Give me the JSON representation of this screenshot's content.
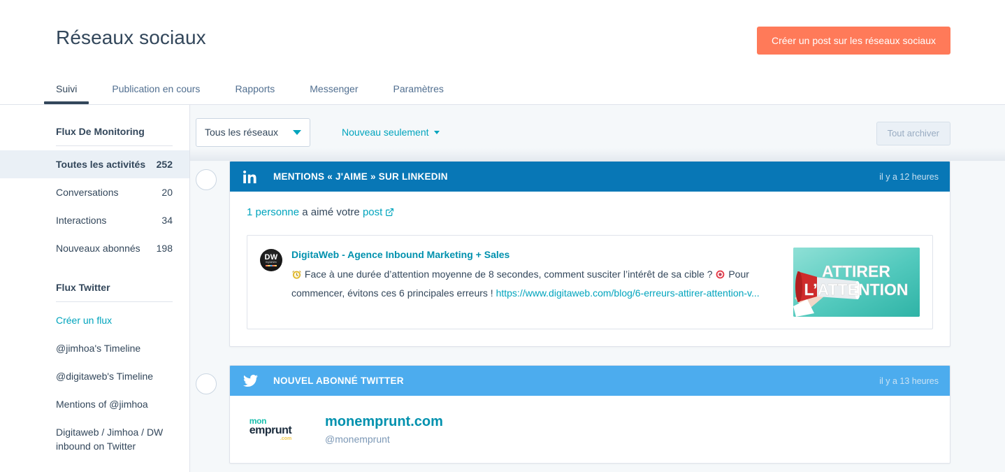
{
  "header": {
    "title": "Réseaux sociaux",
    "primary_button": "Créer un post sur les réseaux sociaux",
    "accent_color": "#ff7a59",
    "tabs": [
      {
        "label": "Suivi",
        "active": true
      },
      {
        "label": "Publication en cours",
        "active": false
      },
      {
        "label": "Rapports",
        "active": false
      },
      {
        "label": "Messenger",
        "active": false
      },
      {
        "label": "Paramètres",
        "active": false
      }
    ]
  },
  "sidebar": {
    "monitoring": {
      "title": "Flux De Monitoring",
      "items": [
        {
          "label": "Toutes les activités",
          "count": "252",
          "selected": true
        },
        {
          "label": "Conversations",
          "count": "20",
          "selected": false
        },
        {
          "label": "Interactions",
          "count": "34",
          "selected": false
        },
        {
          "label": "Nouveaux abonnés",
          "count": "198",
          "selected": false
        }
      ]
    },
    "twitter": {
      "title": "Flux Twitter",
      "items": [
        {
          "label": "Créer un flux",
          "teal": true
        },
        {
          "label": "@jimhoa's Timeline",
          "teal": false
        },
        {
          "label": "@digitaweb's Timeline",
          "teal": false
        },
        {
          "label": "Mentions of @jimhoa",
          "teal": false
        },
        {
          "label": "Digitaweb / Jimhoa / DW inbound on Twitter",
          "teal": false
        }
      ]
    }
  },
  "toolbar": {
    "network_select_value": "Tous les réseaux",
    "filter_link": "Nouveau seulement",
    "archive_button": "Tout archiver"
  },
  "feed": [
    {
      "network": "linkedin",
      "network_color": "#0877b6",
      "icon": "linkedin-icon",
      "header_title": "MENTIONS « J'AIME » SUR LINKEDIN",
      "time": "il y a 12 heures",
      "summary_prefix": "1 personne",
      "summary_mid": " a aimé votre ",
      "summary_link": "post",
      "post": {
        "author": "DigitaWeb - Agence Inbound Marketing + Sales",
        "avatar_initials": "DW",
        "avatar_subtitle": "DigitalWeb",
        "text_part1": " Face à une durée d’attention moyenne de 8 secondes, comment susciter l’intérêt de sa cible ? ",
        "text_part2": " Pour commencer, évitons ces 6 principales erreurs ! ",
        "link": "https://www.digitaweb.com/blog/6-erreurs-attirer-attention-v...",
        "thumbnail_text_line1": "ATTIRER",
        "thumbnail_text_line2": "L’ATTENTION"
      }
    },
    {
      "network": "twitter",
      "network_color": "#4cacee",
      "icon": "twitter-icon",
      "header_title": "NOUVEL ABONNÉ TWITTER",
      "time": "il y a 13 heures",
      "follower": {
        "name": "monemprunt.com",
        "handle": "@monemprunt",
        "logo_line1": "mon",
        "logo_line2": "emprunt",
        "logo_line3": ".com"
      }
    }
  ]
}
